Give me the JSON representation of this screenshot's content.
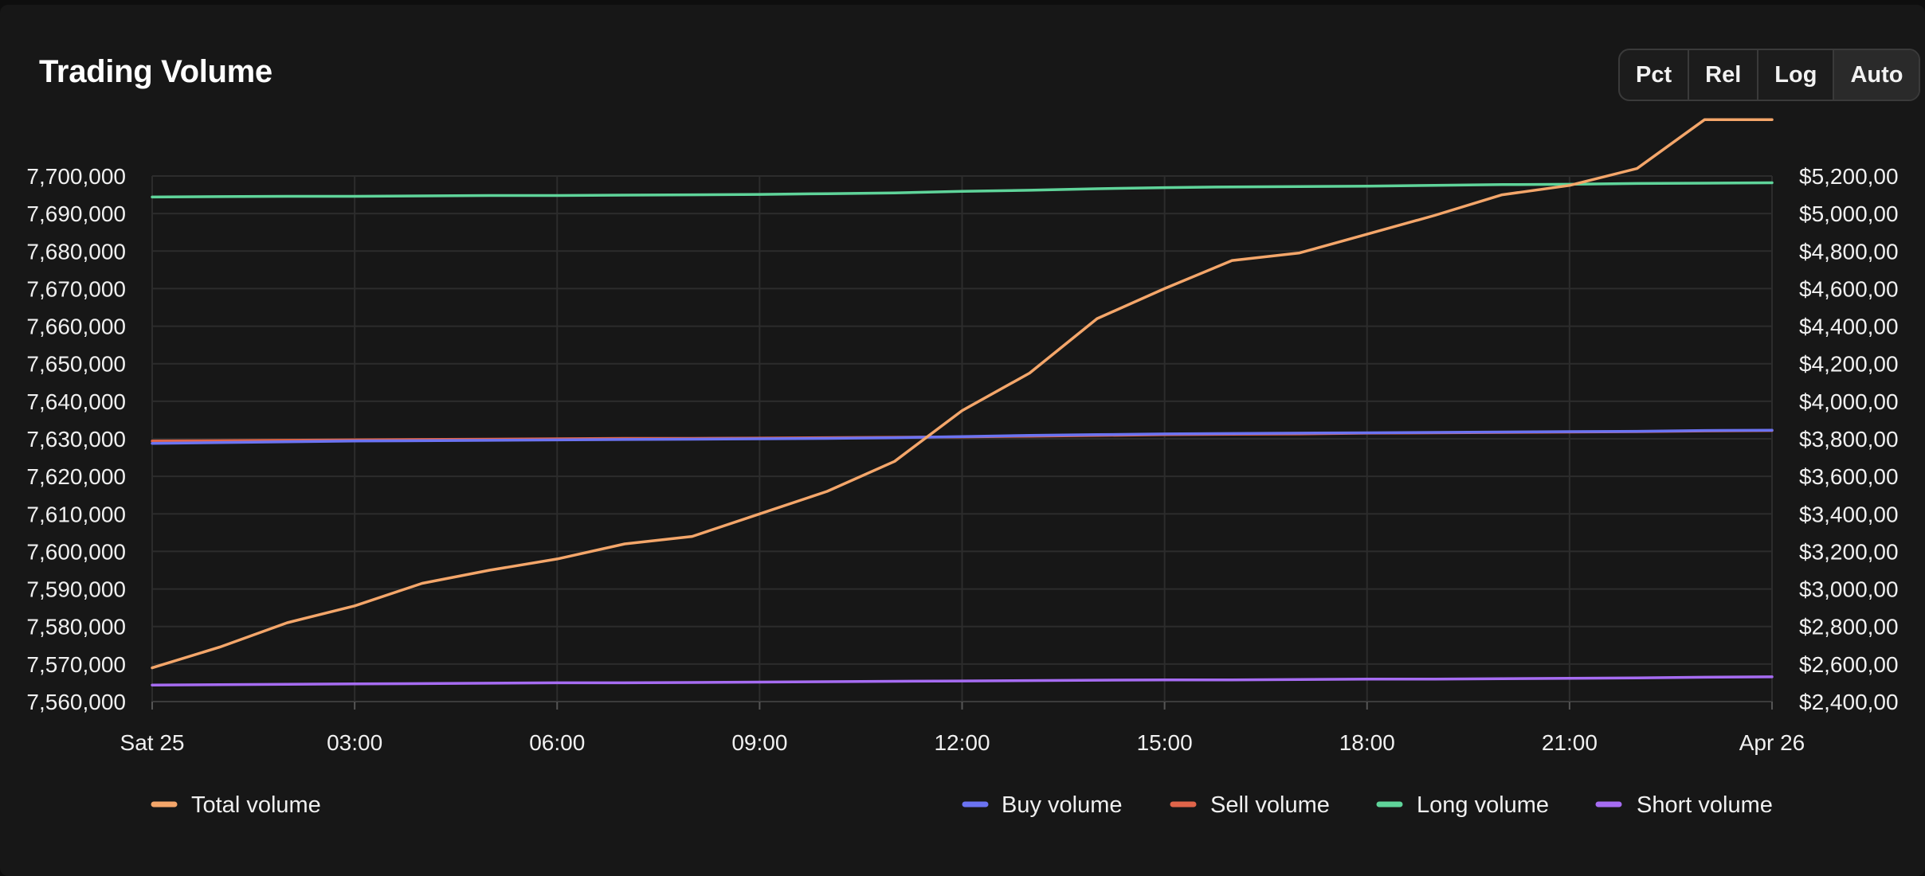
{
  "header": {
    "title": "Trading Volume",
    "modes": [
      {
        "label": "Pct",
        "active": false
      },
      {
        "label": "Rel",
        "active": false
      },
      {
        "label": "Log",
        "active": false
      },
      {
        "label": "Auto",
        "active": true
      }
    ]
  },
  "chart_data": {
    "type": "line",
    "title": "Trading Volume",
    "x_labels": [
      "Sat 25",
      "03:00",
      "06:00",
      "09:00",
      "12:00",
      "15:00",
      "18:00",
      "21:00",
      "Apr 26"
    ],
    "x_hours": [
      0,
      1,
      2,
      3,
      4,
      5,
      6,
      7,
      8,
      9,
      10,
      11,
      12,
      13,
      14,
      15,
      16,
      17,
      18,
      19,
      20,
      21,
      22,
      23,
      24
    ],
    "y_left": {
      "min": 7560000,
      "max": 7700000,
      "ticks": [
        "7,700,000",
        "7,690,000",
        "7,680,000",
        "7,670,000",
        "7,660,000",
        "7,650,000",
        "7,640,000",
        "7,630,000",
        "7,620,000",
        "7,610,000",
        "7,600,000",
        "7,590,000",
        "7,580,000",
        "7,570,000",
        "7,560,000"
      ]
    },
    "y_right": {
      "min": 2400000,
      "max": 5200000,
      "ticks": [
        "$5,200,00",
        "$5,000,00",
        "$4,800,00",
        "$4,600,00",
        "$4,400,00",
        "$4,200,00",
        "$4,000,00",
        "$3,800,00",
        "$3,600,00",
        "$3,400,00",
        "$3,200,00",
        "$3,000,00",
        "$2,800,00",
        "$2,600,00",
        "$2,400,00"
      ]
    },
    "grid": true,
    "legend_position": "bottom",
    "series": [
      {
        "name": "Total volume",
        "axis": "right",
        "color": "#f4a66a",
        "values": [
          2580000,
          2690000,
          2820000,
          2910000,
          3030000,
          3100000,
          3160000,
          3240000,
          3280000,
          3400000,
          3520000,
          3680000,
          3950000,
          4150000,
          4440000,
          4600000,
          4750000,
          4790000,
          4890000,
          4990000,
          5100000,
          5150000,
          5240000,
          5500000,
          5500000
        ]
      },
      {
        "name": "Buy volume",
        "axis": "left",
        "color": "#6b73f2",
        "values": [
          7628800,
          7629000,
          7629200,
          7629400,
          7629500,
          7629600,
          7629700,
          7629800,
          7629900,
          7630000,
          7630100,
          7630300,
          7630600,
          7630900,
          7631100,
          7631300,
          7631400,
          7631500,
          7631600,
          7631700,
          7631800,
          7631900,
          7632000,
          7632200,
          7632300
        ]
      },
      {
        "name": "Sell volume",
        "axis": "left",
        "color": "#e0654a",
        "values": [
          7629400,
          7629500,
          7629600,
          7629700,
          7629800,
          7629900,
          7630000,
          7630100,
          7630100,
          7630200,
          7630300,
          7630400,
          7630500,
          7630700,
          7630900,
          7631100,
          7631200,
          7631300,
          7631500,
          7631600,
          7631700,
          7631800,
          7631900,
          7632100,
          7632200
        ]
      },
      {
        "name": "Long volume",
        "axis": "left",
        "color": "#5fd49a",
        "values": [
          7694400,
          7694500,
          7694600,
          7694600,
          7694700,
          7694800,
          7694800,
          7694900,
          7695000,
          7695100,
          7695300,
          7695500,
          7695900,
          7696200,
          7696600,
          7696900,
          7697100,
          7697200,
          7697300,
          7697500,
          7697700,
          7697800,
          7698000,
          7698100,
          7698200
        ]
      },
      {
        "name": "Short volume",
        "axis": "left",
        "color": "#a66cf2",
        "values": [
          7564400,
          7564500,
          7564600,
          7564700,
          7564800,
          7564900,
          7565000,
          7565000,
          7565100,
          7565200,
          7565300,
          7565400,
          7565500,
          7565600,
          7565700,
          7565800,
          7565800,
          7565900,
          7566000,
          7566000,
          7566100,
          7566200,
          7566300,
          7566500,
          7566600
        ]
      }
    ]
  }
}
